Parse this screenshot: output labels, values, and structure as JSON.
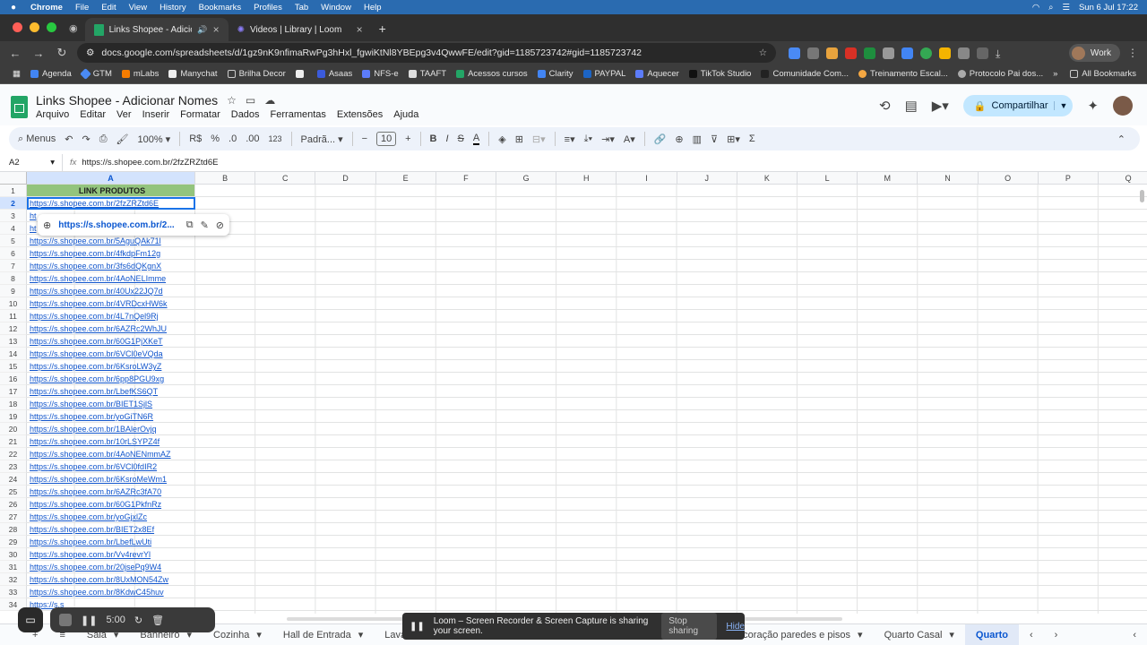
{
  "mac": {
    "menus": [
      "Chrome",
      "File",
      "Edit",
      "View",
      "History",
      "Bookmarks",
      "Profiles",
      "Tab",
      "Window",
      "Help"
    ],
    "clock": "Sun 6 Jul  17:22"
  },
  "tabs": [
    {
      "title": "Links Shopee - Adicionar",
      "active": true
    },
    {
      "title": "Videos | Library | Loom",
      "active": false
    }
  ],
  "address": {
    "url": "docs.google.com/spreadsheets/d/1gz9nK9nfimaRwPg3hHxl_fgwiKtNl8YBEpg3v4QwwFE/edit?gid=1185723742#gid=1185723742"
  },
  "profile": {
    "label": "Work"
  },
  "bookmarks": [
    "Agenda",
    "GTM",
    "mLabs",
    "Manychat",
    "Brilha Decor",
    "",
    "Asaas",
    "NFS-e",
    "TAAFT",
    "Acessos cursos",
    "Clarity",
    "PAYPAL",
    "Aquecer",
    "TikTok Studio",
    "Comunidade Com...",
    "Treinamento Escal...",
    "Protocolo Pai dos..."
  ],
  "bookmarks_all": "All Bookmarks",
  "doc": {
    "title": "Links Shopee - Adicionar Nomes",
    "menu": [
      "Arquivo",
      "Editar",
      "Ver",
      "Inserir",
      "Formatar",
      "Dados",
      "Ferramentas",
      "Extensões",
      "Ajuda"
    ],
    "share_label": "Compartilhar"
  },
  "toolbar": {
    "search": "Menus",
    "zoom": "100%",
    "currency": "R$",
    "percent": "%",
    "dec_less": ".0",
    "dec_more": ".00",
    "num": "123",
    "font": "Padrã...",
    "font_size": "10"
  },
  "formula_bar": {
    "cell_ref": "A2",
    "fx": "fx",
    "value": "https://s.shopee.com.br/2fzZRZtd6E"
  },
  "columns": [
    "A",
    "B",
    "C",
    "D",
    "E",
    "F",
    "G",
    "H",
    "I",
    "J",
    "K",
    "L",
    "M",
    "N",
    "O",
    "P",
    "Q"
  ],
  "rows": [
    {
      "n": "1",
      "a": "LINK PRODUTOS"
    },
    {
      "n": "2",
      "a": "https://s.shopee.com.br/2fzZRZtd6E"
    },
    {
      "n": "3",
      "a": "ht"
    },
    {
      "n": "4",
      "a": "ht"
    },
    {
      "n": "5",
      "a": "https://s.shopee.com.br/5AguQAk71l"
    },
    {
      "n": "6",
      "a": "https://s.shopee.com.br/4fkdpFm12g"
    },
    {
      "n": "7",
      "a": "https://s.shopee.com.br/3fs6dQKgnX"
    },
    {
      "n": "8",
      "a": "https://s.shopee.com.br/4AoNELImme"
    },
    {
      "n": "9",
      "a": "https://s.shopee.com.br/40Ux22JQ7d"
    },
    {
      "n": "10",
      "a": "https://s.shopee.com.br/4VRDcxHW6k"
    },
    {
      "n": "11",
      "a": "https://s.shopee.com.br/4L7nQel9Rj"
    },
    {
      "n": "12",
      "a": "https://s.shopee.com.br/6AZRc2WhJU"
    },
    {
      "n": "13",
      "a": "https://s.shopee.com.br/60G1PjXKeT"
    },
    {
      "n": "14",
      "a": "https://s.shopee.com.br/6VCl0eVQda"
    },
    {
      "n": "15",
      "a": "https://s.shopee.com.br/6KsroLW3yZ"
    },
    {
      "n": "16",
      "a": "https://s.shopee.com.br/6pp8PGU9xg"
    },
    {
      "n": "17",
      "a": "https://s.shopee.com.br/LbefKS6QT"
    },
    {
      "n": "18",
      "a": "https://s.shopee.com.br/BIET1SjlS"
    },
    {
      "n": "19",
      "a": "https://s.shopee.com.br/yoGiTN6R"
    },
    {
      "n": "20",
      "a": "https://s.shopee.com.br/1BAlerOvjq"
    },
    {
      "n": "21",
      "a": "https://s.shopee.com.br/10rLSYPZ4f"
    },
    {
      "n": "22",
      "a": "https://s.shopee.com.br/4AoNENmmAZ"
    },
    {
      "n": "23",
      "a": "https://s.shopee.com.br/6VCl0fdIR2"
    },
    {
      "n": "24",
      "a": "https://s.shopee.com.br/6KsroMeWm1"
    },
    {
      "n": "25",
      "a": "https://s.shopee.com.br/6AZRc3fA70"
    },
    {
      "n": "26",
      "a": "https://s.shopee.com.br/60G1PkfnRz"
    },
    {
      "n": "27",
      "a": "https://s.shopee.com.br/yoGjxlZc"
    },
    {
      "n": "28",
      "a": "https://s.shopee.com.br/BIET2x8Ef"
    },
    {
      "n": "29",
      "a": "https://s.shopee.com.br/LbefLwUti"
    },
    {
      "n": "30",
      "a": "https://s.shopee.com.br/Vv4revrYl"
    },
    {
      "n": "31",
      "a": "https://s.shopee.com.br/20jsePq9W4"
    },
    {
      "n": "32",
      "a": "https://s.shopee.com.br/8UxMON54Zw"
    },
    {
      "n": "33",
      "a": "https://s.shopee.com.br/8KdwC45huv"
    },
    {
      "n": "34",
      "a": "https://s.s"
    }
  ],
  "link_popup": {
    "text": "https://s.shopee.com.br/2..."
  },
  "sheets": [
    "Sala",
    "Banheiro",
    "Cozinha",
    "Hall de Entrada",
    "Lavanderia",
    "Decoração paredes e pisos",
    "Quarto Casal",
    "Quarto"
  ],
  "loom": {
    "timer": "5:00",
    "banner_text": "Loom – Screen Recorder & Screen Capture is sharing your screen.",
    "stop_label": "Stop sharing",
    "hide_label": "Hide"
  }
}
